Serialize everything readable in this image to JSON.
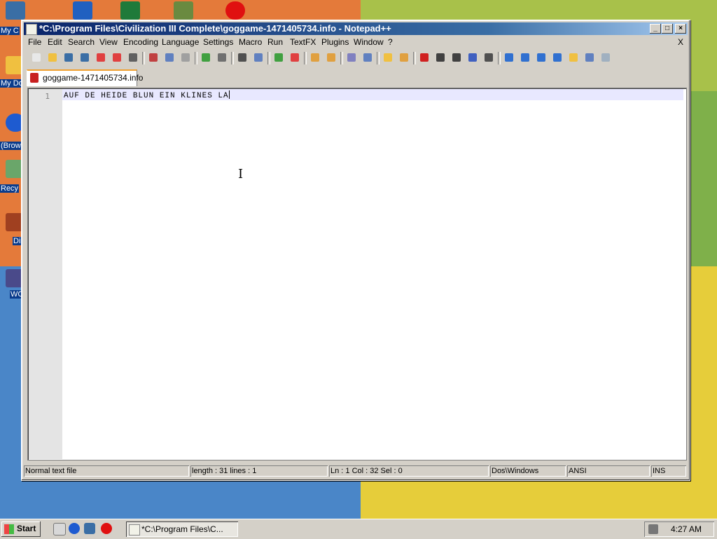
{
  "desktop": {
    "icons": [
      {
        "label": "My C",
        "icon": "my-computer-icon",
        "color": "#3a6ea5"
      },
      {
        "label": "My Do",
        "icon": "my-documents-icon",
        "color": "#f0c040"
      },
      {
        "label": "(Brow",
        "icon": "browser-icon",
        "color": "#1e5bd0"
      },
      {
        "label": "Recy",
        "icon": "recycle-bin-icon",
        "color": "#6aa66a"
      },
      {
        "label": "Di",
        "icon": "shortcut-icon",
        "color": "#a04020"
      },
      {
        "label": "WC",
        "icon": "shortcut-icon",
        "color": "#4a4a8a"
      }
    ],
    "top_icons": [
      {
        "icon": "network-icon",
        "color": "#3a6ea5"
      },
      {
        "icon": "printer-icon",
        "color": "#2060c0"
      },
      {
        "icon": "excel-icon",
        "color": "#1f7a3a"
      },
      {
        "icon": "chart-icon",
        "color": "#6a8a40"
      },
      {
        "icon": "opera-icon",
        "color": "#e01010"
      }
    ]
  },
  "window": {
    "title": "*C:\\Program Files\\Civilization III Complete\\goggame-1471405734.info - Notepad++",
    "buttons": {
      "minimize": "_",
      "maximize": "□",
      "close": "×"
    },
    "menu": [
      "File",
      "Edit",
      "Search",
      "View",
      "Encoding",
      "Language",
      "Settings",
      "Macro",
      "Run",
      "TextFX",
      "Plugins",
      "Window",
      "?"
    ],
    "menu_close": "X",
    "tab": {
      "label": "goggame-1471405734.info"
    },
    "editor": {
      "line_number": "1",
      "text": "AUF DE HEIDE BLUN EIN KLINES LA",
      "ibeam": "I"
    },
    "status": {
      "file_type": "Normal text file",
      "length": "length : 31    lines : 1",
      "position": "Ln : 1    Col : 32    Sel : 0",
      "eol": "Dos\\Windows",
      "encoding": "ANSI",
      "mode": "INS"
    }
  },
  "taskbar": {
    "start_label": "Start",
    "task_label": "*C:\\Program Files\\C...",
    "clock": "4:27 AM"
  },
  "toolbar_icons": [
    "new-file-icon",
    "open-file-icon",
    "save-icon",
    "save-all-icon",
    "close-icon",
    "close-all-icon",
    "print-icon",
    "cut-icon",
    "copy-icon",
    "paste-icon",
    "undo-icon",
    "redo-icon",
    "find-icon",
    "replace-icon",
    "zoom-in-icon",
    "zoom-out-icon",
    "sync-v-icon",
    "sync-h-icon",
    "word-wrap-icon",
    "show-all-icon",
    "indent-guide-icon",
    "user-lang-icon",
    "record-macro-icon",
    "stop-macro-icon",
    "play-macro-icon",
    "run-macro-icon",
    "save-macro-icon",
    "collapse-icon",
    "up-icon",
    "down-icon",
    "expand-icon",
    "folder-icon",
    "console-icon",
    "spellcheck-icon"
  ]
}
